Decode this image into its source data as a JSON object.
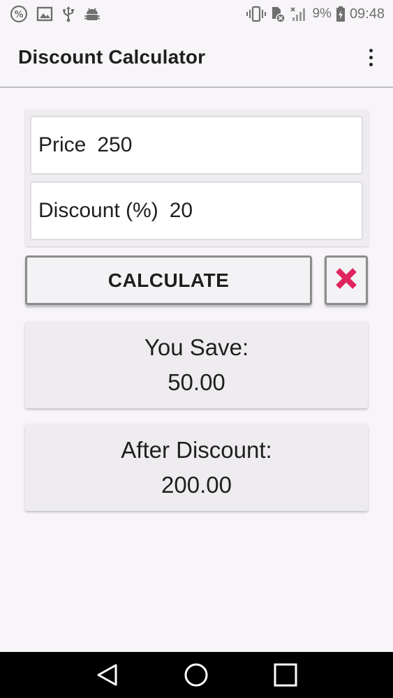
{
  "status_bar": {
    "left_icons": [
      "percent-icon",
      "image-icon",
      "usb-icon",
      "android-debug-icon"
    ],
    "right_icons": [
      "vibrate-icon",
      "sd-card-icon",
      "signal-icon",
      "battery-icon"
    ],
    "battery_text": "9%",
    "time": "09:48"
  },
  "app_bar": {
    "title": "Discount Calculator",
    "menu_icon": "more-vert-icon"
  },
  "form": {
    "price_label": "Price",
    "price_value": "250",
    "discount_label": "Discount (%)",
    "discount_value": "20"
  },
  "actions": {
    "calculate_label": "CALCULATE",
    "clear_icon": "close-icon",
    "clear_color": "#e0245e"
  },
  "results": {
    "save_label": "You Save:",
    "save_value": "50.00",
    "after_label": "After Discount:",
    "after_value": "200.00"
  },
  "nav_bar": {
    "icons": [
      "back-icon",
      "home-icon",
      "recents-icon"
    ]
  }
}
